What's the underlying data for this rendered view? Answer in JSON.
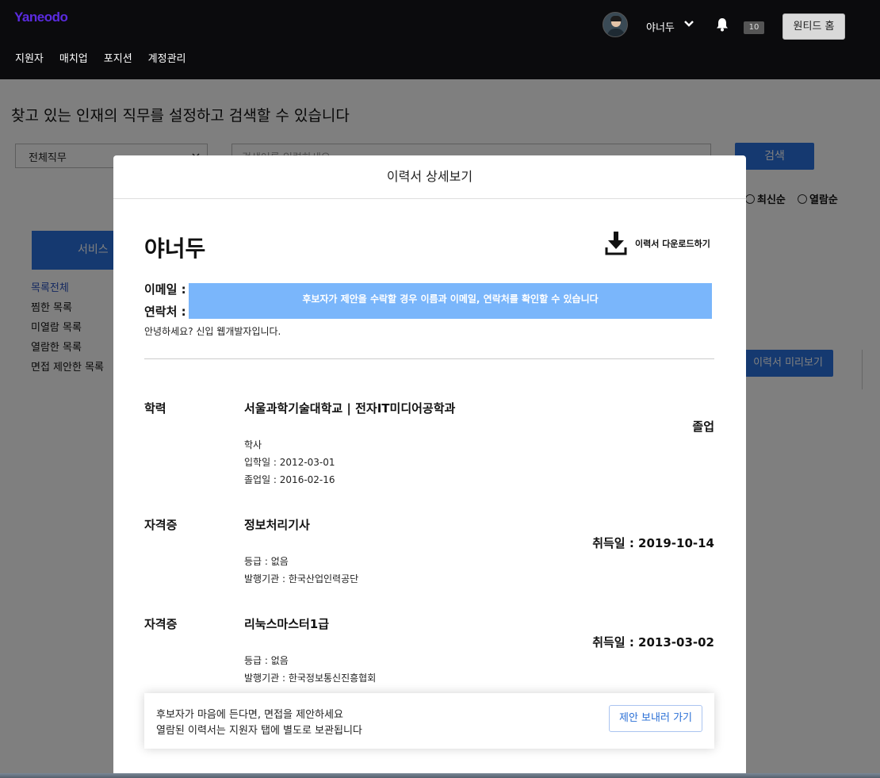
{
  "header": {
    "logo": "Yaneodo",
    "menu": [
      "지원자",
      "매치업",
      "포지션",
      "계정관리"
    ],
    "user_name": "야너두",
    "notification_count": "10",
    "home_button": "원티드 홈"
  },
  "page": {
    "heading": "찾고 있는 인재의 직무를 설정하고 검색할 수 있습니다",
    "job_select": "전체직무",
    "search_placeholder": "검색어를 입력하세요",
    "search_button": "검색",
    "sort_latest": "최신순",
    "sort_views": "열람순",
    "service_button": "서비스 ",
    "side_menu": [
      "목록전체",
      "찜한 목록",
      "미열람 목록",
      "열람한 목록",
      "면접 제안한 목록"
    ],
    "preview_button": "이력서 미리보기"
  },
  "modal": {
    "title": "이력서 상세보기",
    "name": "야너두",
    "download": "이력서 다운로드하기",
    "email_label": "이메일 :",
    "phone_label": "연락처 :",
    "privacy_notice": "후보자가 제안을 수락할 경우 이름과 이메일, 연락처를 확인할 수 있습니다",
    "intro": "안녕하세요? 신입 웹개발자입니다.",
    "education": {
      "label": "학력",
      "school": "서울과학기술대학교 | 전자IT미디어공학과",
      "status": "졸업",
      "degree": "학사",
      "admission": "입학일 : 2012-03-01",
      "graduation": "졸업일 : 2016-02-16"
    },
    "certificates": [
      {
        "label": "자격증",
        "name": "정보처리기사",
        "acquired": "취득일 : 2019-10-14",
        "grade": "등급 : 없음",
        "issuer": "발행기관 : 한국산업인력공단"
      },
      {
        "label": "자격증",
        "name": "리눅스마스터1급",
        "acquired": "취득일 : 2013-03-02",
        "grade": "등급 : 없음",
        "issuer": "발행기관 : 한국정보통신진흥협회"
      }
    ],
    "cta": {
      "line1": "후보자가 마음에 든다면, 면접을 제안하세요",
      "line2": "열람된 이력서는 지원자 탭에 별도로 보관됩니다",
      "button": "제안 보내러 가기"
    }
  }
}
